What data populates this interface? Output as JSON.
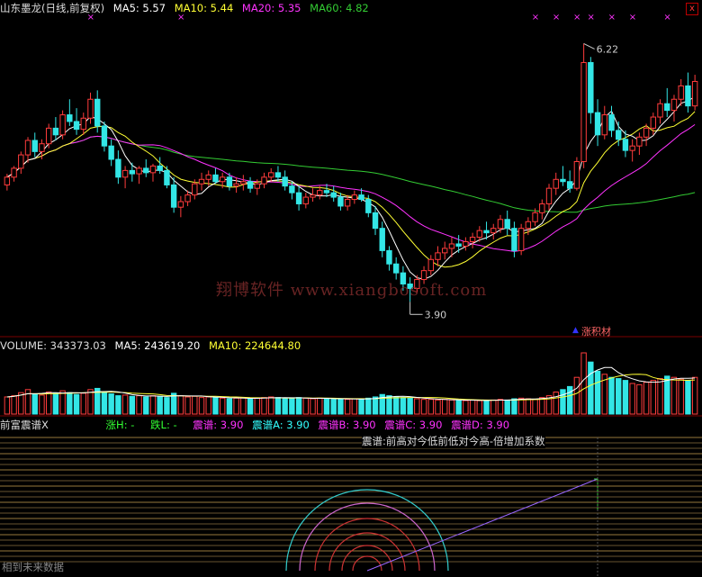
{
  "main_legend": {
    "title": "山东墨龙(日线,前复权)",
    "ma5": "MA5: 5.57",
    "ma10": "MA10: 5.44",
    "ma20": "MA20: 5.35",
    "ma60": "MA60: 4.82",
    "close_symbol": "x"
  },
  "colors": {
    "up": "#ff3c3c",
    "down": "#33e6e6",
    "ma5": "#ffffff",
    "ma10": "#ffff33",
    "ma20": "#ff33ff",
    "ma60": "#33cc33",
    "text": "#cccccc",
    "grid": "#7a0000"
  },
  "volume_legend": {
    "volume": "VOLUME: 343373.03",
    "ma5": "MA5: 243619.20",
    "ma10": "MA10: 224644.80"
  },
  "indicator_legend": {
    "name": "前富震谱X",
    "zhang_h": "涨H: -",
    "die_l": "跌L: -",
    "zhenpu": "震谱: 3.90",
    "zhenpu_a": "震谱A: 3.90",
    "zhenpu_b": "震谱B: 3.90",
    "zhenpu_c": "震谱C: 3.90",
    "zhenpu_d": "震谱D: 3.90"
  },
  "annotations": {
    "high_label": "6.22",
    "low_label": "3.90",
    "tag_label": "涨积材",
    "indicator_note": "震谱:前高对今低前低对今高-倍增加系数",
    "future_note": "相到未来数据",
    "watermark": "翔博软件 www.xiangbosoft.com"
  },
  "chart_data": {
    "type": "candlestick",
    "title": "山东墨龙(日线,前复权)",
    "ylim": [
      3.7,
      6.45
    ],
    "series": [
      {
        "name": "MA5",
        "last": 5.57
      },
      {
        "name": "MA10",
        "last": 5.44
      },
      {
        "name": "MA20",
        "last": 5.35
      },
      {
        "name": "MA60",
        "last": 4.82
      }
    ],
    "ohlc": [
      [
        4.95,
        5.05,
        4.9,
        5.02
      ],
      [
        5.02,
        5.12,
        4.98,
        5.1
      ],
      [
        5.1,
        5.25,
        5.05,
        5.22
      ],
      [
        5.22,
        5.38,
        5.15,
        5.35
      ],
      [
        5.35,
        5.42,
        5.2,
        5.25
      ],
      [
        5.25,
        5.36,
        5.18,
        5.32
      ],
      [
        5.32,
        5.5,
        5.28,
        5.46
      ],
      [
        5.46,
        5.56,
        5.35,
        5.4
      ],
      [
        5.4,
        5.62,
        5.36,
        5.58
      ],
      [
        5.58,
        5.72,
        5.48,
        5.52
      ],
      [
        5.52,
        5.64,
        5.4,
        5.45
      ],
      [
        5.45,
        5.6,
        5.4,
        5.55
      ],
      [
        5.55,
        5.78,
        5.5,
        5.72
      ],
      [
        5.72,
        5.8,
        5.42,
        5.48
      ],
      [
        5.48,
        5.52,
        5.25,
        5.3
      ],
      [
        5.3,
        5.36,
        5.12,
        5.18
      ],
      [
        5.18,
        5.26,
        4.96,
        5.02
      ],
      [
        5.02,
        5.12,
        4.92,
        5.08
      ],
      [
        5.08,
        5.15,
        4.98,
        5.05
      ],
      [
        5.05,
        5.12,
        4.96,
        5.1
      ],
      [
        5.1,
        5.18,
        5.02,
        5.06
      ],
      [
        5.06,
        5.14,
        4.98,
        5.12
      ],
      [
        5.12,
        5.2,
        5.05,
        5.08
      ],
      [
        5.08,
        5.12,
        4.92,
        4.95
      ],
      [
        4.95,
        5.02,
        4.7,
        4.75
      ],
      [
        4.75,
        4.85,
        4.66,
        4.8
      ],
      [
        4.8,
        4.9,
        4.76,
        4.86
      ],
      [
        4.86,
        5.0,
        4.82,
        4.96
      ],
      [
        4.96,
        5.06,
        4.9,
        5.0
      ],
      [
        5.0,
        5.08,
        4.94,
        5.04
      ],
      [
        5.04,
        5.1,
        4.96,
        4.98
      ],
      [
        4.98,
        5.06,
        4.92,
        5.02
      ],
      [
        5.02,
        5.06,
        4.9,
        4.94
      ],
      [
        4.94,
        5.02,
        4.88,
        4.96
      ],
      [
        4.96,
        5.04,
        4.9,
        4.98
      ],
      [
        4.98,
        5.02,
        4.88,
        4.92
      ],
      [
        4.92,
        5.0,
        4.86,
        4.96
      ],
      [
        4.96,
        5.06,
        4.92,
        5.02
      ],
      [
        5.02,
        5.1,
        4.98,
        5.06
      ],
      [
        5.06,
        5.12,
        4.98,
        5.02
      ],
      [
        5.02,
        5.08,
        4.9,
        4.94
      ],
      [
        4.94,
        4.98,
        4.82,
        4.88
      ],
      [
        4.88,
        4.94,
        4.72,
        4.78
      ],
      [
        4.78,
        4.88,
        4.74,
        4.84
      ],
      [
        4.84,
        4.92,
        4.8,
        4.86
      ],
      [
        4.86,
        4.94,
        4.82,
        4.9
      ],
      [
        4.9,
        4.96,
        4.84,
        4.88
      ],
      [
        4.88,
        4.94,
        4.8,
        4.84
      ],
      [
        4.84,
        4.88,
        4.72,
        4.76
      ],
      [
        4.76,
        4.86,
        4.72,
        4.82
      ],
      [
        4.82,
        4.9,
        4.78,
        4.86
      ],
      [
        4.86,
        4.92,
        4.8,
        4.82
      ],
      [
        4.82,
        4.86,
        4.66,
        4.7
      ],
      [
        4.7,
        4.76,
        4.5,
        4.56
      ],
      [
        4.56,
        4.62,
        4.3,
        4.36
      ],
      [
        4.36,
        4.4,
        4.18,
        4.24
      ],
      [
        4.24,
        4.3,
        4.1,
        4.16
      ],
      [
        4.16,
        4.22,
        4.0,
        4.06
      ],
      [
        4.06,
        4.12,
        3.9,
        4.02
      ],
      [
        4.02,
        4.14,
        3.98,
        4.1
      ],
      [
        4.1,
        4.22,
        4.06,
        4.18
      ],
      [
        4.18,
        4.32,
        4.14,
        4.28
      ],
      [
        4.28,
        4.4,
        4.22,
        4.34
      ],
      [
        4.34,
        4.44,
        4.28,
        4.38
      ],
      [
        4.38,
        4.48,
        4.3,
        4.42
      ],
      [
        4.42,
        4.5,
        4.34,
        4.4
      ],
      [
        4.4,
        4.48,
        4.36,
        4.44
      ],
      [
        4.44,
        4.52,
        4.38,
        4.48
      ],
      [
        4.48,
        4.58,
        4.44,
        4.54
      ],
      [
        4.54,
        4.62,
        4.46,
        4.52
      ],
      [
        4.52,
        4.6,
        4.46,
        4.56
      ],
      [
        4.56,
        4.68,
        4.52,
        4.64
      ],
      [
        4.64,
        4.72,
        4.5,
        4.56
      ],
      [
        4.56,
        4.62,
        4.3,
        4.36
      ],
      [
        4.36,
        4.6,
        4.32,
        4.56
      ],
      [
        4.56,
        4.66,
        4.5,
        4.62
      ],
      [
        4.62,
        4.74,
        4.58,
        4.7
      ],
      [
        4.7,
        4.82,
        4.64,
        4.78
      ],
      [
        4.78,
        4.96,
        4.72,
        4.92
      ],
      [
        4.92,
        5.06,
        4.86,
        5.0
      ],
      [
        5.0,
        5.12,
        4.94,
        4.98
      ],
      [
        4.98,
        5.08,
        4.88,
        4.92
      ],
      [
        4.92,
        5.2,
        4.9,
        5.16
      ],
      [
        5.16,
        6.22,
        5.1,
        6.05
      ],
      [
        6.05,
        6.1,
        5.5,
        5.6
      ],
      [
        5.6,
        5.72,
        5.3,
        5.4
      ],
      [
        5.4,
        5.66,
        5.36,
        5.58
      ],
      [
        5.58,
        5.66,
        5.38,
        5.44
      ],
      [
        5.44,
        5.52,
        5.3,
        5.36
      ],
      [
        5.36,
        5.44,
        5.2,
        5.26
      ],
      [
        5.26,
        5.36,
        5.16,
        5.3
      ],
      [
        5.3,
        5.42,
        5.22,
        5.38
      ],
      [
        5.38,
        5.5,
        5.3,
        5.46
      ],
      [
        5.46,
        5.6,
        5.4,
        5.56
      ],
      [
        5.56,
        5.72,
        5.5,
        5.68
      ],
      [
        5.68,
        5.82,
        5.56,
        5.62
      ],
      [
        5.62,
        5.76,
        5.52,
        5.72
      ],
      [
        5.72,
        5.9,
        5.66,
        5.84
      ],
      [
        5.84,
        5.96,
        5.6,
        5.66
      ],
      [
        5.66,
        5.94,
        5.62,
        5.88
      ]
    ],
    "volume": [
      28,
      30,
      35,
      40,
      33,
      31,
      36,
      34,
      38,
      35,
      32,
      34,
      40,
      42,
      36,
      33,
      30,
      31,
      29,
      30,
      28,
      30,
      29,
      27,
      34,
      30,
      28,
      29,
      27,
      28,
      27,
      26,
      25,
      26,
      27,
      25,
      26,
      27,
      28,
      27,
      26,
      25,
      27,
      26,
      25,
      26,
      25,
      24,
      25,
      24,
      25,
      24,
      26,
      28,
      32,
      30,
      28,
      27,
      26,
      25,
      24,
      24,
      23,
      24,
      23,
      22,
      22,
      23,
      22,
      22,
      23,
      24,
      23,
      25,
      26,
      25,
      24,
      27,
      30,
      36,
      40,
      45,
      60,
      100,
      85,
      70,
      65,
      60,
      58,
      55,
      50,
      48,
      52,
      55,
      58,
      62,
      60,
      57,
      55,
      60
    ],
    "volume_series": [
      {
        "name": "VOLUME",
        "last": 343373.03
      },
      {
        "name": "MA5",
        "last": 243619.2
      },
      {
        "name": "MA10",
        "last": 224644.8
      }
    ]
  }
}
